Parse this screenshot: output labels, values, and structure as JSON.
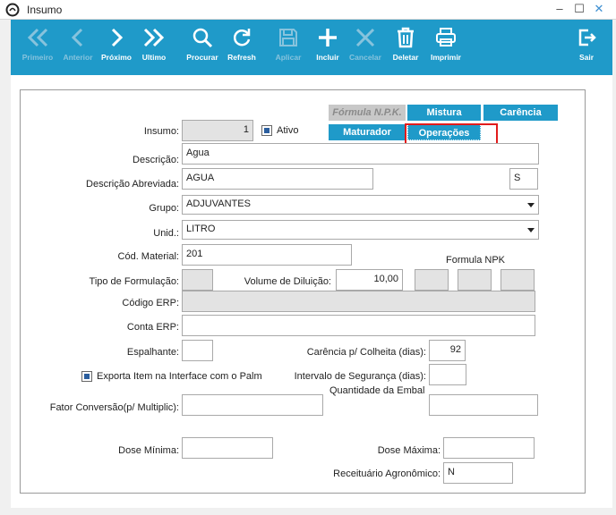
{
  "window": {
    "title": "Insumo"
  },
  "toolbar": {
    "first": "Primeiro",
    "previous": "Anterior",
    "next": "Próximo",
    "last": "Ultimo",
    "search": "Procurar",
    "refresh": "Refresh",
    "save": "Aplicar",
    "add": "Incluir",
    "cancel": "Cancelar",
    "delete": "Deletar",
    "print": "Imprimir",
    "exit": "Sair"
  },
  "tabs": {
    "formula_npk": "Fórmula N.P.K.",
    "mistura": "Mistura",
    "carencia": "Carência",
    "maturador": "Maturador",
    "operacoes": "Operações"
  },
  "form": {
    "insumo_label": "Insumo:",
    "insumo_value": "1",
    "ativo_label": "Ativo",
    "descricao_label": "Descrição:",
    "descricao_value": "Agua",
    "descricao_abrev_label": "Descrição Abreviada:",
    "descricao_abrev_value": "AGUA",
    "flag_value": "S",
    "grupo_label": "Grupo:",
    "grupo_value": "ADJUVANTES",
    "unid_label": "Unid.:",
    "unid_value": "LITRO",
    "cod_material_label": "Cód. Material:",
    "cod_material_value": "201",
    "formula_npk_label": "Formula NPK",
    "tipo_formulacao_label": "Tipo de Formulação:",
    "volume_diluicao_label": "Volume de Diluição:",
    "volume_diluicao_value": "10,00",
    "codigo_erp_label": "Código ERP:",
    "conta_erp_label": "Conta ERP:",
    "espalhante_label": "Espalhante:",
    "carencia_colheita_label": "Carência p/ Colheita (dias):",
    "carencia_colheita_value": "92",
    "exporta_label": "Exporta Item na Interface com o Palm",
    "intervalo_seguranca_label": "Intervalo de Segurança (dias):",
    "quantidade_embal_label": "Quantidade da Embal",
    "fator_conversao_label": "Fator Conversão(p/ Multiplic):",
    "dose_minima_label": "Dose Mínima:",
    "dose_maxima_label": "Dose Máxima:",
    "receituario_label": "Receituário Agronômico:",
    "receituario_value": "N"
  },
  "checkboxes": {
    "ativo": true,
    "exporta": true
  },
  "colors": {
    "toolbar": "#1f9ac9",
    "tab": "#1f9ac9",
    "highlight": "#e21b1b"
  }
}
